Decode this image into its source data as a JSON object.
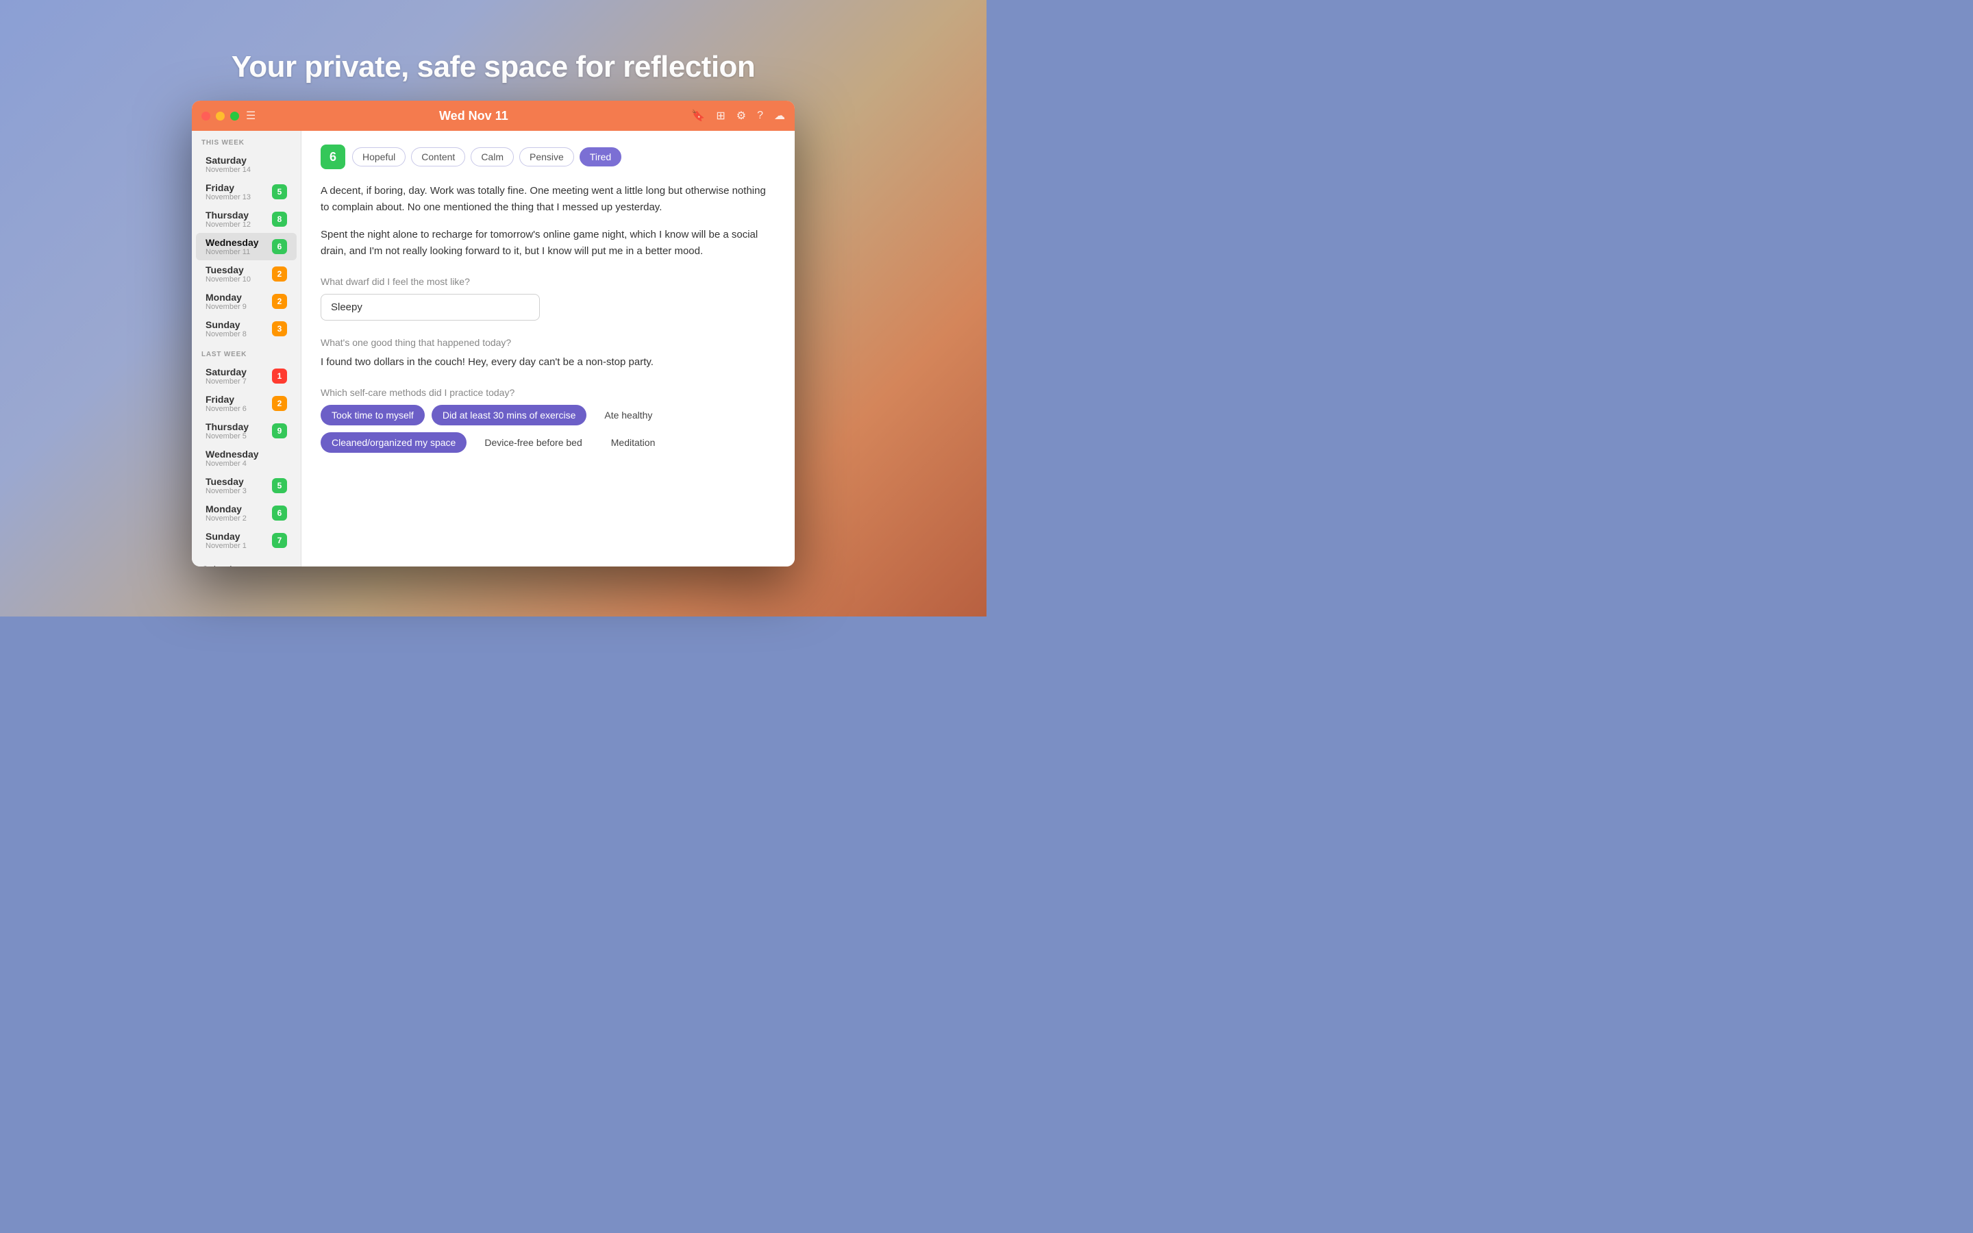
{
  "page": {
    "title": "Your private, safe space for reflection"
  },
  "titlebar": {
    "date": "Wed Nov 11",
    "icons": [
      "bookmark",
      "grid",
      "gear",
      "question",
      "cloud"
    ]
  },
  "sidebar": {
    "this_week_label": "THIS WEEK",
    "last_week_label": "LAST WEEK",
    "this_week_items": [
      {
        "day": "Saturday",
        "date": "November 14",
        "badge": null,
        "badge_color": ""
      },
      {
        "day": "Friday",
        "date": "November 13",
        "badge": "5",
        "badge_color": "badge-green"
      },
      {
        "day": "Thursday",
        "date": "November 12",
        "badge": "8",
        "badge_color": "badge-green"
      },
      {
        "day": "Wednesday",
        "date": "November 11",
        "badge": "6",
        "badge_color": "badge-green",
        "active": true
      },
      {
        "day": "Tuesday",
        "date": "November 10",
        "badge": "2",
        "badge_color": "badge-orange"
      },
      {
        "day": "Monday",
        "date": "November 9",
        "badge": "2",
        "badge_color": "badge-orange"
      },
      {
        "day": "Sunday",
        "date": "November 8",
        "badge": "3",
        "badge_color": "badge-orange"
      }
    ],
    "last_week_items": [
      {
        "day": "Saturday",
        "date": "November 7",
        "badge": "1",
        "badge_color": "badge-red"
      },
      {
        "day": "Friday",
        "date": "November 6",
        "badge": "2",
        "badge_color": "badge-orange"
      },
      {
        "day": "Thursday",
        "date": "November 5",
        "badge": "9",
        "badge_color": "badge-green"
      },
      {
        "day": "Wednesday",
        "date": "November 4",
        "badge": null,
        "badge_color": ""
      },
      {
        "day": "Tuesday",
        "date": "November 3",
        "badge": "5",
        "badge_color": "badge-green"
      },
      {
        "day": "Monday",
        "date": "November 2",
        "badge": "6",
        "badge_color": "badge-green"
      },
      {
        "day": "Sunday",
        "date": "November 1",
        "badge": "7",
        "badge_color": "badge-green"
      }
    ],
    "calendar_link": "Calendar"
  },
  "journal": {
    "mood_score": "6",
    "mood_tags": [
      {
        "label": "Hopeful",
        "selected": false
      },
      {
        "label": "Content",
        "selected": false
      },
      {
        "label": "Calm",
        "selected": false
      },
      {
        "label": "Pensive",
        "selected": false
      },
      {
        "label": "Tired",
        "selected": true
      }
    ],
    "entry_paragraphs": [
      "A decent, if boring, day. Work was totally fine. One meeting went a little long but otherwise nothing to complain about. No one mentioned the thing that I messed up yesterday.",
      "Spent the night alone to recharge for tomorrow's online game night, which I know will be a social drain, and I'm not really looking forward to it, but I know will put me in a better mood."
    ],
    "dwarf_question": "What dwarf did I feel the most like?",
    "dwarf_answer": "Sleepy",
    "good_thing_question": "What's one good thing that happened today?",
    "good_thing_answer": "I found two dollars in the couch! Hey, every day can't be a non-stop party.",
    "selfcare_question": "Which self-care methods did I practice today?",
    "selfcare_tags": [
      {
        "label": "Took time to myself",
        "selected": true
      },
      {
        "label": "Did at least 30 mins of exercise",
        "selected": true
      },
      {
        "label": "Ate healthy",
        "selected": false
      },
      {
        "label": "Cleaned/organized my space",
        "selected": true
      },
      {
        "label": "Device-free before bed",
        "selected": false
      },
      {
        "label": "Meditation",
        "selected": false
      }
    ]
  }
}
